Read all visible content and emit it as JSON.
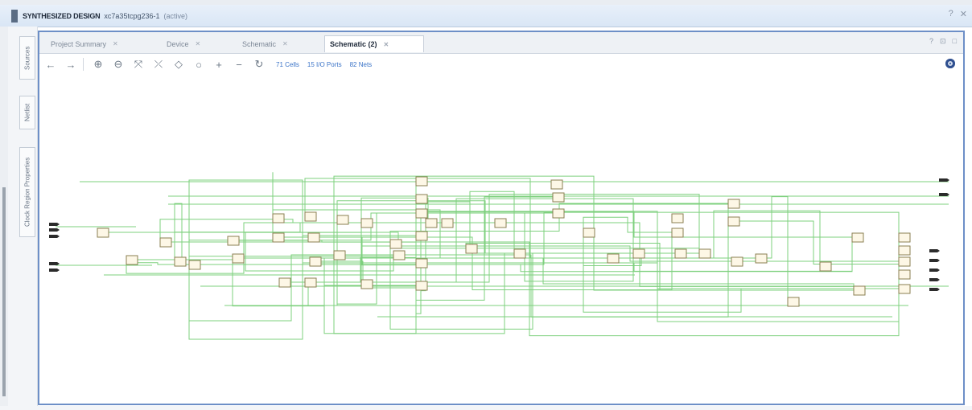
{
  "header": {
    "title": "SYNTHESIZED DESIGN",
    "part": "xc7a35tcpg236-1",
    "state": "(active)",
    "help_icon": "?",
    "close_icon": "✕"
  },
  "left_rail": {
    "tabs": [
      "Sources",
      "Netlist",
      "Clock Region Properties"
    ]
  },
  "tabs": [
    {
      "label": "Project Summary",
      "active": false
    },
    {
      "label": "Device",
      "active": false
    },
    {
      "label": "Schematic",
      "active": false
    },
    {
      "label": "Schematic (2)",
      "active": true
    }
  ],
  "tab_controls": {
    "help": "?",
    "restore": "⊡",
    "maximize": "□"
  },
  "toolbar": {
    "buttons": [
      "back-icon",
      "forward-icon",
      "zoom-in-icon",
      "zoom-out-icon",
      "zoom-fit-icon",
      "zoom-area-icon",
      "expand-icon",
      "collapse-icon",
      "add-icon",
      "remove-icon",
      "refresh-icon"
    ],
    "cells_link": "71 Cells",
    "ports_link": "15 I/O Ports",
    "nets_link": "82 Nets",
    "settings_icon": "gear-icon"
  },
  "colors": {
    "wire": "#7ed07e",
    "cell_fill": "#fdf7e6",
    "cell_stroke": "#8a7f52",
    "port": "#2b2b2b",
    "panel_border": "#6d8fc7",
    "link": "#3a73c7"
  }
}
